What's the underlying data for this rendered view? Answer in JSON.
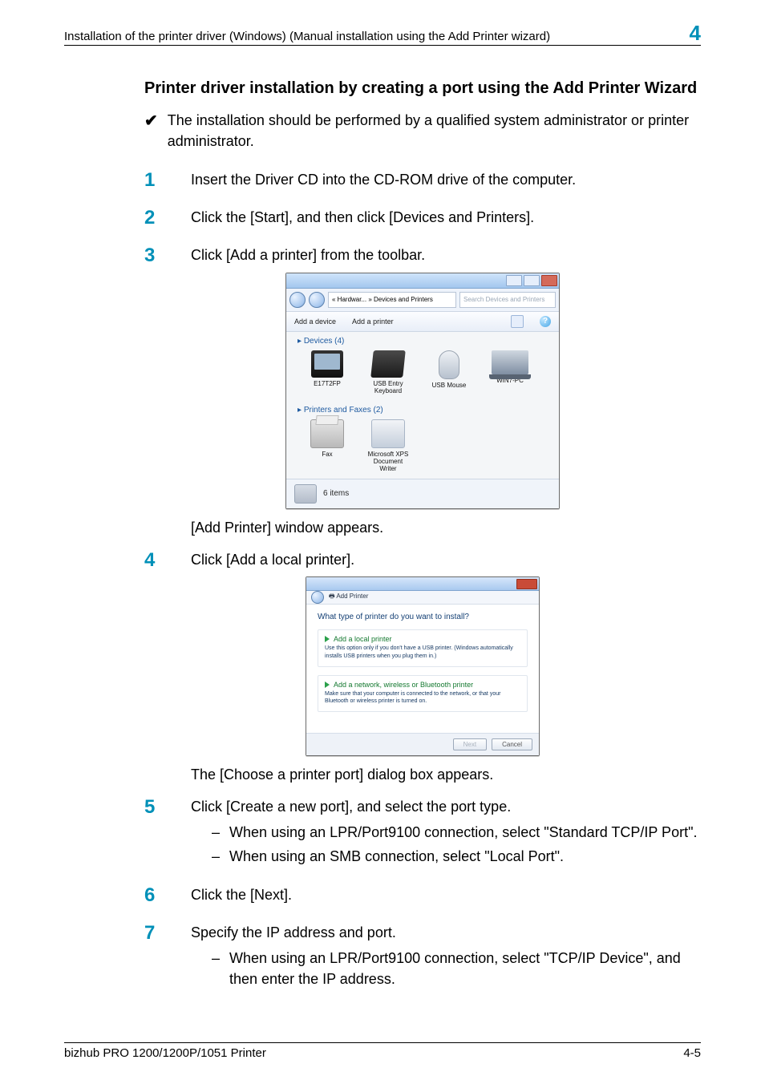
{
  "header": {
    "title": "Installation of the printer driver (Windows) (Manual installation using the Add Printer wizard)",
    "chapter_number": "4"
  },
  "heading": "Printer driver installation by creating a port using the Add Printer Wizard",
  "checkmark_text": "The installation should be performed by a qualified system administrator or printer administrator.",
  "steps": {
    "s1": {
      "num": "1",
      "body": "Insert the Driver CD into the CD-ROM drive of the computer."
    },
    "s2": {
      "num": "2",
      "body": "Click the [Start], and then click [Devices and Printers]."
    },
    "s3": {
      "num": "3",
      "body": "Click [Add a printer] from the toolbar."
    },
    "s3_result": "[Add Printer] window appears.",
    "s4": {
      "num": "4",
      "body": "Click [Add a local printer]."
    },
    "s4_result": "The [Choose a printer port] dialog box appears.",
    "s5": {
      "num": "5",
      "body": "Click [Create a new port], and select the port type.",
      "sub": [
        "When using an LPR/Port9100 connection, select \"Standard TCP/IP Port\".",
        "When using an SMB connection, select \"Local Port\"."
      ]
    },
    "s6": {
      "num": "6",
      "body": "Click the [Next]."
    },
    "s7": {
      "num": "7",
      "body": "Specify the IP address and port.",
      "sub": [
        "When using an LPR/Port9100 connection, select \"TCP/IP Device\", and then enter the IP address."
      ]
    }
  },
  "screenshot1": {
    "addressbar": "« Hardwar... » Devices and Printers",
    "search_placeholder": "Search Devices and Printers",
    "toolbar": {
      "add_device": "Add a device",
      "add_printer": "Add a printer"
    },
    "section_devices": "Devices (4)",
    "dev_names": {
      "monitor": "E17T2FP",
      "kbd": "USB Entry Keyboard",
      "mouse": "USB Mouse",
      "laptop": "WIN7-PC"
    },
    "section_printers": "Printers and Faxes (2)",
    "printer_names": {
      "fax": "Fax",
      "xps": "Microsoft XPS Document Writer"
    },
    "statusbar_text": "6 items"
  },
  "screenshot2": {
    "breadcrumb": "Add Printer",
    "question": "What type of printer do you want to install?",
    "opt1_title": "Add a local printer",
    "opt1_desc": "Use this option only if you don't have a USB printer. (Windows automatically installs USB printers when you plug them in.)",
    "opt2_title": "Add a network, wireless or Bluetooth printer",
    "opt2_desc": "Make sure that your computer is connected to the network, or that your Bluetooth or wireless printer is turned on.",
    "btn_next": "Next",
    "btn_cancel": "Cancel"
  },
  "footer": {
    "product": "bizhub PRO 1200/1200P/1051 Printer",
    "page": "4-5"
  }
}
